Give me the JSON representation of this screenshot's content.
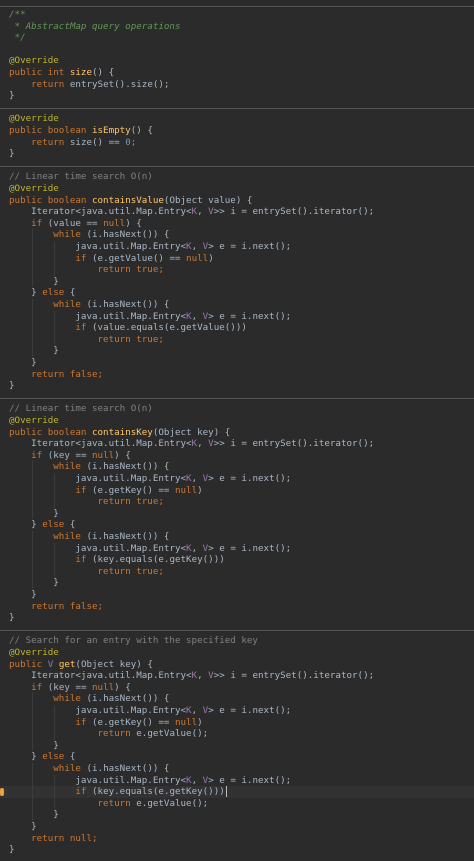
{
  "editor": {
    "theme": {
      "background": "#2b2b2b",
      "text": "#a9b7c6",
      "keyword": "#cc7832",
      "annotation": "#bbb529",
      "method": "#ffc66d",
      "comment": "#808080",
      "doc_comment": "#629755",
      "number": "#6897bb",
      "type_param": "#9876aa",
      "separator": "#555555",
      "breakpoint": "#e8a33c"
    },
    "lines": [
      [
        [
          "/**",
          "d"
        ]
      ],
      [
        [
          " * AbstractMap query operations",
          "d"
        ]
      ],
      [
        [
          " */",
          "d"
        ]
      ],
      [],
      [
        [
          "@Override",
          "a"
        ]
      ],
      [
        [
          "public int ",
          "k"
        ],
        [
          "size",
          "m"
        ],
        [
          "() {",
          "p"
        ]
      ],
      [
        [
          "    ",
          "p"
        ],
        [
          "return ",
          "k"
        ],
        [
          "entrySet().size();",
          "p"
        ]
      ],
      [
        [
          "}",
          "p"
        ]
      ],
      [],
      [
        [
          "@Override",
          "a"
        ]
      ],
      [
        [
          "public boolean ",
          "k"
        ],
        [
          "isEmpty",
          "m"
        ],
        [
          "() {",
          "p"
        ]
      ],
      [
        [
          "    ",
          "p"
        ],
        [
          "return ",
          "k"
        ],
        [
          "size() == ",
          "p"
        ],
        [
          "0",
          "n"
        ],
        [
          ";",
          "k"
        ]
      ],
      [
        [
          "}",
          "p"
        ]
      ],
      [],
      [
        [
          "// Linear time search O(n)",
          "c"
        ]
      ],
      [
        [
          "@Override",
          "a"
        ]
      ],
      [
        [
          "public boolean ",
          "k"
        ],
        [
          "containsValue",
          "m"
        ],
        [
          "(Object value) {",
          "p"
        ]
      ],
      [
        [
          "    Iterator<java.util.Map.Entry<",
          "p"
        ],
        [
          "K",
          "t"
        ],
        [
          ", ",
          "p"
        ],
        [
          "V",
          "t"
        ],
        [
          ">> i = entrySet().iterator();",
          "p"
        ]
      ],
      [
        [
          "    ",
          "p"
        ],
        [
          "if ",
          "k"
        ],
        [
          "(value == ",
          "p"
        ],
        [
          "null",
          "k"
        ],
        [
          ") {",
          "p"
        ]
      ],
      [
        [
          "        ",
          "p"
        ],
        [
          "while ",
          "k"
        ],
        [
          "(i.hasNext()) {",
          "p"
        ]
      ],
      [
        [
          "            java.util.Map.Entry<",
          "p"
        ],
        [
          "K",
          "t"
        ],
        [
          ", ",
          "p"
        ],
        [
          "V",
          "t"
        ],
        [
          "> e = i.next();",
          "p"
        ]
      ],
      [
        [
          "            ",
          "p"
        ],
        [
          "if ",
          "k"
        ],
        [
          "(e.getValue() == ",
          "p"
        ],
        [
          "null",
          "k"
        ],
        [
          ")",
          "p"
        ]
      ],
      [
        [
          "                ",
          "p"
        ],
        [
          "return true",
          "k"
        ],
        [
          ";",
          "k"
        ]
      ],
      [
        [
          "        }",
          "p"
        ]
      ],
      [
        [
          "    } ",
          "p"
        ],
        [
          "else ",
          "k"
        ],
        [
          "{",
          "p"
        ]
      ],
      [
        [
          "        ",
          "p"
        ],
        [
          "while ",
          "k"
        ],
        [
          "(i.hasNext()) {",
          "p"
        ]
      ],
      [
        [
          "            java.util.Map.Entry<",
          "p"
        ],
        [
          "K",
          "t"
        ],
        [
          ", ",
          "p"
        ],
        [
          "V",
          "t"
        ],
        [
          "> e = i.next();",
          "p"
        ]
      ],
      [
        [
          "            ",
          "p"
        ],
        [
          "if ",
          "k"
        ],
        [
          "(value.equals(e.getValue()))",
          "p"
        ]
      ],
      [
        [
          "                ",
          "p"
        ],
        [
          "return true",
          "k"
        ],
        [
          ";",
          "k"
        ]
      ],
      [
        [
          "        }",
          "p"
        ]
      ],
      [
        [
          "    }",
          "p"
        ]
      ],
      [
        [
          "    ",
          "p"
        ],
        [
          "return false",
          "k"
        ],
        [
          ";",
          "k"
        ]
      ],
      [
        [
          "}",
          "p"
        ]
      ],
      [],
      [
        [
          "// Linear time search O(n)",
          "c"
        ]
      ],
      [
        [
          "@Override",
          "a"
        ]
      ],
      [
        [
          "public boolean ",
          "k"
        ],
        [
          "containsKey",
          "m"
        ],
        [
          "(Object key) {",
          "p"
        ]
      ],
      [
        [
          "    Iterator<java.util.Map.Entry<",
          "p"
        ],
        [
          "K",
          "t"
        ],
        [
          ", ",
          "p"
        ],
        [
          "V",
          "t"
        ],
        [
          ">> i = entrySet().iterator();",
          "p"
        ]
      ],
      [
        [
          "    ",
          "p"
        ],
        [
          "if ",
          "k"
        ],
        [
          "(key == ",
          "p"
        ],
        [
          "null",
          "k"
        ],
        [
          ") {",
          "p"
        ]
      ],
      [
        [
          "        ",
          "p"
        ],
        [
          "while ",
          "k"
        ],
        [
          "(i.hasNext()) {",
          "p"
        ]
      ],
      [
        [
          "            java.util.Map.Entry<",
          "p"
        ],
        [
          "K",
          "t"
        ],
        [
          ", ",
          "p"
        ],
        [
          "V",
          "t"
        ],
        [
          "> e = i.next();",
          "p"
        ]
      ],
      [
        [
          "            ",
          "p"
        ],
        [
          "if ",
          "k"
        ],
        [
          "(e.getKey() == ",
          "p"
        ],
        [
          "null",
          "k"
        ],
        [
          ")",
          "p"
        ]
      ],
      [
        [
          "                ",
          "p"
        ],
        [
          "return true",
          "k"
        ],
        [
          ";",
          "k"
        ]
      ],
      [
        [
          "        }",
          "p"
        ]
      ],
      [
        [
          "    } ",
          "p"
        ],
        [
          "else ",
          "k"
        ],
        [
          "{",
          "p"
        ]
      ],
      [
        [
          "        ",
          "p"
        ],
        [
          "while ",
          "k"
        ],
        [
          "(i.hasNext()) {",
          "p"
        ]
      ],
      [
        [
          "            java.util.Map.Entry<",
          "p"
        ],
        [
          "K",
          "t"
        ],
        [
          ", ",
          "p"
        ],
        [
          "V",
          "t"
        ],
        [
          "> e = i.next();",
          "p"
        ]
      ],
      [
        [
          "            ",
          "p"
        ],
        [
          "if ",
          "k"
        ],
        [
          "(key.equals(e.getKey()))",
          "p"
        ]
      ],
      [
        [
          "                ",
          "p"
        ],
        [
          "return true",
          "k"
        ],
        [
          ";",
          "k"
        ]
      ],
      [
        [
          "        }",
          "p"
        ]
      ],
      [
        [
          "    }",
          "p"
        ]
      ],
      [
        [
          "    ",
          "p"
        ],
        [
          "return false",
          "k"
        ],
        [
          ";",
          "k"
        ]
      ],
      [
        [
          "}",
          "p"
        ]
      ],
      [],
      [
        [
          "// Search for an entry with the specified key",
          "c"
        ]
      ],
      [
        [
          "@Override",
          "a"
        ]
      ],
      [
        [
          "public ",
          "k"
        ],
        [
          "V ",
          "t"
        ],
        [
          "get",
          "m"
        ],
        [
          "(Object key) {",
          "p"
        ]
      ],
      [
        [
          "    Iterator<java.util.Map.Entry<",
          "p"
        ],
        [
          "K",
          "t"
        ],
        [
          ", ",
          "p"
        ],
        [
          "V",
          "t"
        ],
        [
          ">> i = entrySet().iterator();",
          "p"
        ]
      ],
      [
        [
          "    ",
          "p"
        ],
        [
          "if ",
          "k"
        ],
        [
          "(key == ",
          "p"
        ],
        [
          "null",
          "k"
        ],
        [
          ") {",
          "p"
        ]
      ],
      [
        [
          "        ",
          "p"
        ],
        [
          "while ",
          "k"
        ],
        [
          "(i.hasNext()) {",
          "p"
        ]
      ],
      [
        [
          "            java.util.Map.Entry<",
          "p"
        ],
        [
          "K",
          "t"
        ],
        [
          ", ",
          "p"
        ],
        [
          "V",
          "t"
        ],
        [
          "> e = i.next();",
          "p"
        ]
      ],
      [
        [
          "            ",
          "p"
        ],
        [
          "if ",
          "k"
        ],
        [
          "(e.getKey() == ",
          "p"
        ],
        [
          "null",
          "k"
        ],
        [
          ")",
          "p"
        ]
      ],
      [
        [
          "                ",
          "p"
        ],
        [
          "return ",
          "k"
        ],
        [
          "e.getValue();",
          "p"
        ]
      ],
      [
        [
          "        }",
          "p"
        ]
      ],
      [
        [
          "    } ",
          "p"
        ],
        [
          "else ",
          "k"
        ],
        [
          "{",
          "p"
        ]
      ],
      [
        [
          "        ",
          "p"
        ],
        [
          "while ",
          "k"
        ],
        [
          "(i.hasNext()) {",
          "p"
        ]
      ],
      [
        [
          "            java.util.Map.Entry<",
          "p"
        ],
        [
          "K",
          "t"
        ],
        [
          ", ",
          "p"
        ],
        [
          "V",
          "t"
        ],
        [
          "> e = i.next();",
          "p"
        ]
      ],
      [
        [
          "            ",
          "p"
        ],
        [
          "if ",
          "k"
        ],
        [
          "(key.equals(e.getKey()))",
          "p"
        ]
      ],
      [
        [
          "                ",
          "p"
        ],
        [
          "return ",
          "k"
        ],
        [
          "e.getValue();",
          "p"
        ]
      ],
      [
        [
          "        }",
          "p"
        ]
      ],
      [
        [
          "    }",
          "p"
        ]
      ],
      [
        [
          "    ",
          "p"
        ],
        [
          "return null",
          "k"
        ],
        [
          ";",
          "k"
        ]
      ],
      [
        [
          "}",
          "p"
        ]
      ]
    ]
  }
}
